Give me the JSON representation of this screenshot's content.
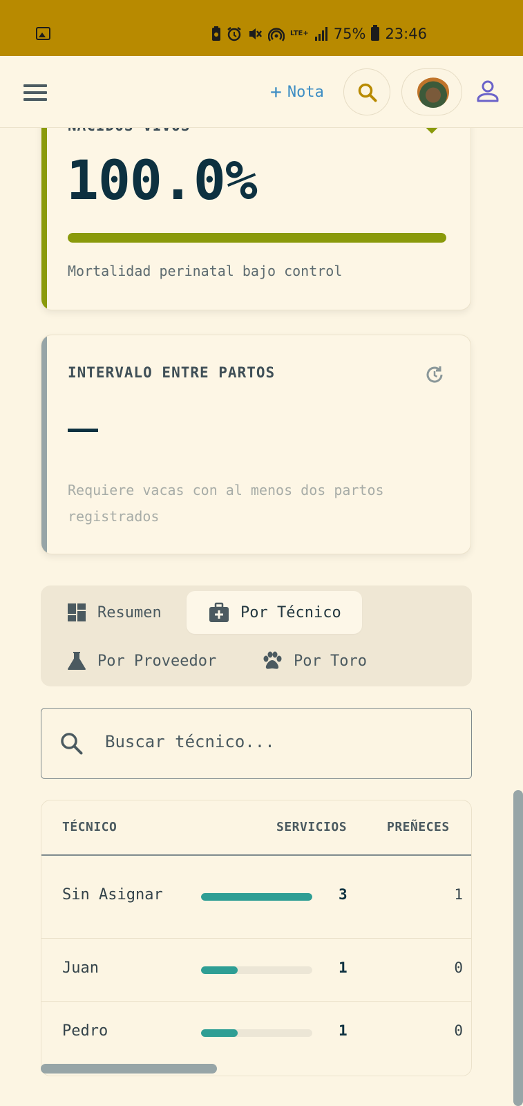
{
  "status_bar": {
    "battery_text": "75%",
    "time": "23:46",
    "network": "LTE+",
    "icons": [
      "image-icon",
      "battery-saver-icon",
      "alarm-icon",
      "vibrate-off-icon",
      "hotspot-icon",
      "lte-icon",
      "signal-icon",
      "battery-icon"
    ]
  },
  "app_bar": {
    "note_label": "Nota",
    "icons": [
      "menu-icon",
      "plus-icon",
      "search-icon",
      "avatar",
      "user-icon"
    ],
    "colors": {
      "note": "#3f8ec4",
      "search": "#b88a00",
      "user": "#6b63c9"
    }
  },
  "card_nacidos": {
    "label": "NACIDOS VIVOS",
    "value": "100.0%",
    "progress_percent": 100,
    "note": "Mortalidad perinatal bajo control",
    "accent_color": "#8a9a0b"
  },
  "card_intervalo": {
    "label": "INTERVALO ENTRE PARTOS",
    "value": "—",
    "note": "Requiere vacas con al menos dos partos registrados",
    "accent_color": "#97a5a7"
  },
  "tabs": [
    {
      "label": "Resumen",
      "icon": "dashboard-icon",
      "active": false
    },
    {
      "label": "Por Técnico",
      "icon": "medical-bag-icon",
      "active": true
    },
    {
      "label": "Por Proveedor",
      "icon": "flask-icon",
      "active": false
    },
    {
      "label": "Por Toro",
      "icon": "paw-icon",
      "active": false
    }
  ],
  "search": {
    "placeholder": "Buscar técnico..."
  },
  "table": {
    "headers": {
      "tecnico": "TÉCNICO",
      "servicios": "SERVICIOS",
      "prenez": "PREÑECES"
    },
    "rows": [
      {
        "name": "Sin Asignar",
        "servicios": "3",
        "prenez": "1",
        "bar_fraction": 1.0
      },
      {
        "name": "Juan",
        "servicios": "1",
        "prenez": "0",
        "bar_fraction": 0.33
      },
      {
        "name": "Pedro",
        "servicios": "1",
        "prenez": "0",
        "bar_fraction": 0.33
      }
    ],
    "bar_color": "#2e9e94"
  }
}
